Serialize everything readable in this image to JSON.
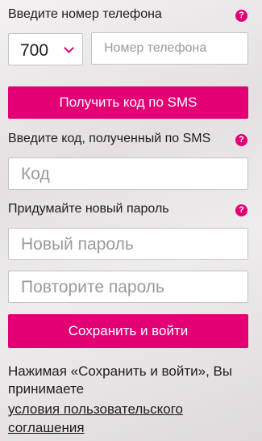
{
  "phone_section": {
    "label": "Введите номер телефона",
    "help_icon": "question-icon",
    "country_code": "700",
    "phone_placeholder": "Номер телефона"
  },
  "sms_button": {
    "label": "Получить код по SMS"
  },
  "code_section": {
    "label": "Введите код, полученный по SMS",
    "help_icon": "question-icon",
    "code_placeholder": "Код"
  },
  "password_section": {
    "label": "Придумайте новый пароль",
    "help_icon": "question-icon",
    "new_password_placeholder": "Новый пароль",
    "repeat_password_placeholder": "Повторите пароль"
  },
  "save_button": {
    "label": "Сохранить и войти"
  },
  "agreement": {
    "line1": "Нажимая «Сохранить и войти», Вы",
    "line2": "принимаете",
    "link_line1": "условия пользовательского",
    "link_line2": "соглашения"
  },
  "colors": {
    "accent": "#e20074",
    "field_border": "#c4c4c4",
    "placeholder": "#9a9a9a"
  }
}
